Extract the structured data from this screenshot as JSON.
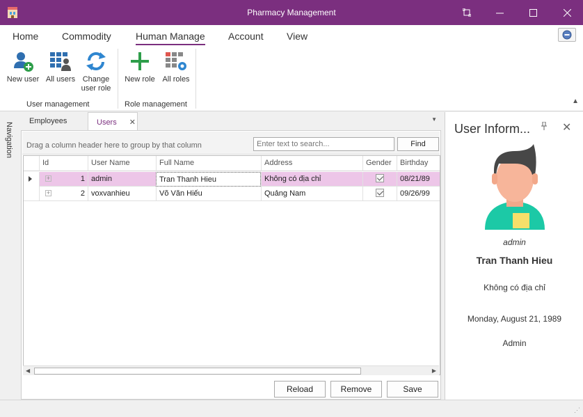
{
  "window": {
    "title": "Pharmacy Management",
    "controls": [
      "minimize",
      "restore",
      "maximize",
      "close"
    ]
  },
  "ribbon": {
    "tabs": [
      {
        "label": "Home"
      },
      {
        "label": "Commodity"
      },
      {
        "label": "Human Manage"
      },
      {
        "label": "Account"
      },
      {
        "label": "View"
      }
    ],
    "active_tab": "Human Manage",
    "groups": [
      {
        "label": "User management",
        "buttons": [
          {
            "label_line1": "New user",
            "label_line2": "",
            "icon": "add-user-icon"
          },
          {
            "label_line1": "All users",
            "label_line2": "",
            "icon": "users-grid-icon"
          },
          {
            "label_line1": "Change",
            "label_line2": "user role",
            "icon": "refresh-icon"
          }
        ]
      },
      {
        "label": "Role management",
        "buttons": [
          {
            "label_line1": "New role",
            "label_line2": "",
            "icon": "plus-icon"
          },
          {
            "label_line1": "All roles",
            "label_line2": "",
            "icon": "roles-gear-icon"
          }
        ]
      }
    ]
  },
  "navigation": {
    "label": "Navigation"
  },
  "doc_tabs": [
    {
      "label": "Employees"
    },
    {
      "label": "Users",
      "closable": true
    }
  ],
  "grid": {
    "group_hint": "Drag a column header here to group by that column",
    "search_placeholder": "Enter text to search...",
    "find_label": "Find",
    "columns": [
      "Id",
      "User Name",
      "Full Name",
      "Address",
      "Gender",
      "Birthday"
    ],
    "rows": [
      {
        "id": "1",
        "username": "admin",
        "fullname": "Tran Thanh Hieu",
        "address": "Không có địa chỉ",
        "gender": true,
        "birthday": "08/21/89"
      },
      {
        "id": "2",
        "username": "voxvanhieu",
        "fullname": "Võ Văn Hiếu",
        "address": "Quảng Nam",
        "gender": true,
        "birthday": "09/26/99"
      }
    ],
    "selected_row": 0
  },
  "actions": {
    "reload": "Reload",
    "remove": "Remove",
    "save": "Save"
  },
  "user_info": {
    "title": "User Inform...",
    "username": "admin",
    "fullname": "Tran Thanh Hieu",
    "address": "Không có địa chỉ",
    "birthday": "Monday, August 21, 1989",
    "role": "Admin"
  },
  "colors": {
    "accent": "#7b2f7f",
    "selection": "#edc6e8"
  }
}
